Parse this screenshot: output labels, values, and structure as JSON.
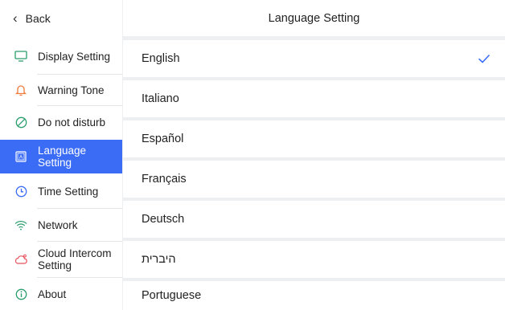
{
  "sidebar": {
    "back_label": "Back",
    "items": [
      {
        "label": "Display Setting",
        "icon": "monitor-icon"
      },
      {
        "label": "Warning Tone",
        "icon": "bell-icon"
      },
      {
        "label": "Do not disturb",
        "icon": "do-not-disturb-icon"
      },
      {
        "label": "Language\nSetting",
        "icon": "language-icon"
      },
      {
        "label": "Time Setting",
        "icon": "clock-icon"
      },
      {
        "label": "Network",
        "icon": "wifi-icon"
      },
      {
        "label": "Cloud Intercom\nSetting",
        "icon": "cloud-icon"
      },
      {
        "label": "About",
        "icon": "info-icon"
      }
    ],
    "active_index": 3
  },
  "header": {
    "title": "Language Setting"
  },
  "languages": {
    "options": [
      "English",
      "Italiano",
      "Español",
      "Français",
      "Deutsch",
      "היברית",
      "Portuguese"
    ],
    "selected": "English"
  },
  "colors": {
    "accent": "#3b6cf6",
    "icon_default": "#2a9e6c",
    "warning_icon": "#f07a3c",
    "cloud_icon": "#e8505b",
    "background": "#eeeff1"
  }
}
